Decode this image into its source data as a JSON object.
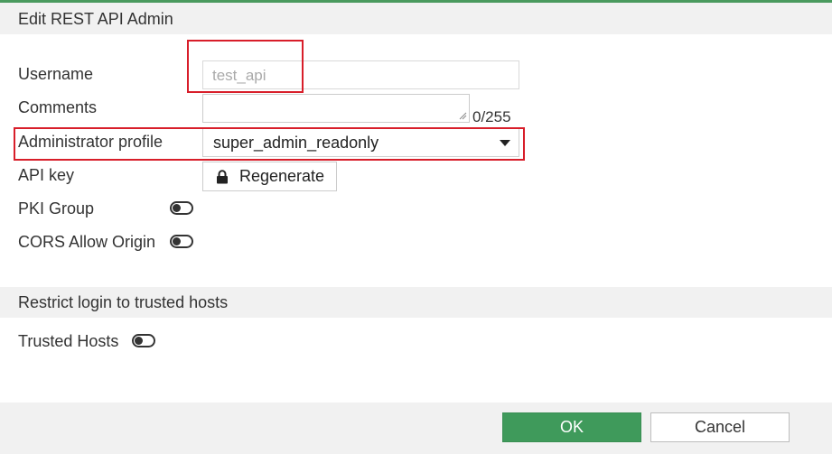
{
  "dialog": {
    "title": "Edit REST API Admin"
  },
  "form": {
    "username": {
      "label": "Username",
      "value": "test_api"
    },
    "comments": {
      "label": "Comments",
      "value": "",
      "counter": "0/255"
    },
    "admin_profile": {
      "label": "Administrator profile",
      "selected": "super_admin_readonly"
    },
    "api_key": {
      "label": "API key",
      "button_label": "Regenerate",
      "icon": "lock-icon"
    },
    "pki_group": {
      "label": "PKI Group",
      "enabled": false
    },
    "cors": {
      "label": "CORS Allow Origin",
      "enabled": false
    }
  },
  "restrict_section": {
    "title": "Restrict login to trusted hosts",
    "trusted_hosts": {
      "label": "Trusted Hosts",
      "enabled": false
    }
  },
  "footer": {
    "ok_label": "OK",
    "cancel_label": "Cancel"
  },
  "colors": {
    "accent": "#3f9a5b",
    "highlight": "#d81e2a",
    "header_bg": "#f1f1f1"
  }
}
